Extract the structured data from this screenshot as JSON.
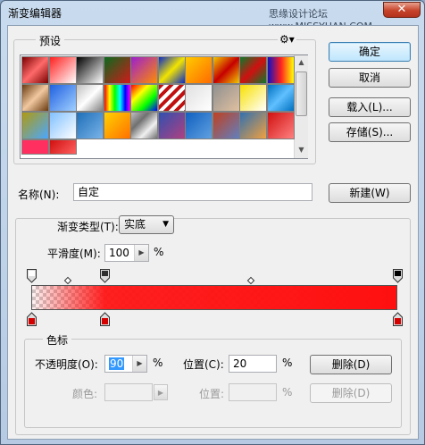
{
  "window": {
    "title": "渐变编辑器",
    "watermark": "思缘设计论坛 www.MISSYUAN.COM",
    "close_glyph": "✕"
  },
  "presets": {
    "label": "预设",
    "menu_icon": "gear-icon",
    "swatches": [
      "linear-gradient(135deg,#7a0000,#ff6a6a,#7a0000)",
      "linear-gradient(135deg,#ff2020,#ffffff)",
      "linear-gradient(135deg,#000000,#ffffff)",
      "linear-gradient(135deg,#0a6a1e,#d11919)",
      "linear-gradient(135deg,#9b1fd0,#ff8c00)",
      "linear-gradient(135deg,#0a2ac8,#f2e400,#0a2ac8)",
      "linear-gradient(135deg,#ffcc00,#ff6a00)",
      "linear-gradient(135deg,#f0c800,#c60000,#f0c800)",
      "linear-gradient(135deg,#0a7a2a,#d01010,#0a7a2a)",
      "linear-gradient(90deg,#1010c0,#ff2020,#ffff00)",
      "linear-gradient(135deg,#6a3a10,#f0c8a0,#6a3a10)",
      "linear-gradient(135deg,#2060e0,#a0d0ff)",
      "linear-gradient(135deg,#c0c0c0,#ffffff,#808080)",
      "linear-gradient(90deg,#f00,#ff0,#0f0,#0ff,#00f,#f0f)",
      "linear-gradient(135deg,#ff0000,#ffff00,#00ff00,#0000ff)",
      "repeating-linear-gradient(135deg,#c01010 0 4px,#ffffff 4px 8px)",
      "linear-gradient(135deg,#e0e0e0,#ffffff)",
      "linear-gradient(135deg,#909090,#e0c0a0)",
      "linear-gradient(135deg,#f8e000,#ffffff)",
      "linear-gradient(135deg,#0070c0,#60c0ff,#0070c0)",
      "linear-gradient(135deg,#b09a10,#4aa8ff)",
      "linear-gradient(135deg,#80c0ff,#ffffff)",
      "linear-gradient(135deg,#1e6eb8,#7ab4e8)",
      "linear-gradient(135deg,#ffd200,#ff7000)",
      "linear-gradient(135deg,#c0c0c0,#707070,#f0f0f0,#707070)",
      "linear-gradient(135deg,#3050b0,#b04080)",
      "linear-gradient(135deg,#1060c0,#60a0e0)",
      "linear-gradient(135deg,#c04020,#6080c0)",
      "linear-gradient(135deg,#3070b0,#f0a040)",
      "linear-gradient(135deg,#d01010,#ff8080)",
      "linear-gradient(90deg,#ff3060,#ff3060)",
      "linear-gradient(135deg,#d01010,#ff6060)"
    ]
  },
  "buttons": {
    "ok": "确定",
    "cancel": "取消",
    "load": "载入(L)...",
    "save": "存储(S)...",
    "new": "新建(W)"
  },
  "name": {
    "label": "名称(N):",
    "value": "自定"
  },
  "gradient_type": {
    "label": "渐变类型(T):",
    "value": "实底"
  },
  "smoothness": {
    "label": "平滑度(M):",
    "value": "100",
    "unit": "%"
  },
  "gradient": {
    "css": "linear-gradient(90deg, rgba(240,40,40,0.05) 0%, rgba(255,20,20,0.95) 20%, #ff1010 100%)",
    "opacity_stops": [
      {
        "location_pct": 0,
        "color": "#ffffff"
      },
      {
        "location_pct": 20,
        "color": "#303030"
      },
      {
        "location_pct": 100,
        "color": "#000000"
      }
    ],
    "color_stops": [
      {
        "location_pct": 0,
        "color": "#d40000"
      },
      {
        "location_pct": 20,
        "color": "#d40000"
      },
      {
        "location_pct": 100,
        "color": "#d40000"
      }
    ],
    "opacity_midpoints_pct": [
      10,
      60
    ]
  },
  "stops_group": {
    "label": "色标",
    "opacity_label": "不透明度(O):",
    "opacity_value": "90",
    "opacity_unit": "%",
    "location_label": "位置(C):",
    "location_value": "20",
    "location_unit": "%",
    "delete_label": "删除(D)",
    "color_label": "颜色:",
    "color_location_label": "位置:",
    "color_location_unit": "%",
    "color_delete_label": "删除(D)"
  }
}
